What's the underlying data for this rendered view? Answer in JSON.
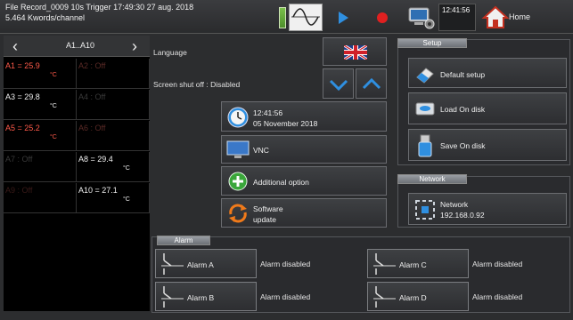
{
  "topbar": {
    "record_line": "File Record_0009  10s  Trigger 17:49:30 27 aug. 2018",
    "size_line": "5.464 Kwords/channel",
    "clock_time": "12:41:56",
    "home_label": "Home"
  },
  "channels": {
    "range_label": "A1..A10",
    "items": [
      {
        "value": "A1 = 25.9",
        "unit": "°C",
        "color": "#ff5a4a"
      },
      {
        "value": "A2 : Off",
        "unit": "",
        "color": "#5a2a26"
      },
      {
        "value": "A3 = 29.8",
        "unit": "°C",
        "color": "#f0f0f0"
      },
      {
        "value": "A4 : Off",
        "unit": "",
        "color": "#3a3a3a"
      },
      {
        "value": "A5 = 25.2",
        "unit": "°C",
        "color": "#ff5a4a"
      },
      {
        "value": "A6 : Off",
        "unit": "",
        "color": "#5a2a26"
      },
      {
        "value": "A7 : Off",
        "unit": "",
        "color": "#3a3a3a"
      },
      {
        "value": "A8 = 29.4",
        "unit": "°C",
        "color": "#f0f0f0"
      },
      {
        "value": "A9 : Off",
        "unit": "",
        "color": "#3a1a18"
      },
      {
        "value": "A10 = 27.1",
        "unit": "°C",
        "color": "#f0f0f0"
      }
    ]
  },
  "settings": {
    "language_label": "Language",
    "screen_shutoff_label": "Screen shut off : Disabled",
    "datetime_time": "12:41:56",
    "datetime_date": "05 November 2018",
    "vnc_label": "VNC",
    "additional_option_label": "Additional option",
    "software_update_line1": "Software",
    "software_update_line2": "update"
  },
  "setup": {
    "header": "Setup",
    "default_setup": "Default setup",
    "load_on_disk": "Load On disk",
    "save_on_disk": "Save On disk"
  },
  "network": {
    "header": "Network",
    "label": "Network",
    "ip": "192.168.0.92"
  },
  "alarm": {
    "header": "Alarm",
    "items": [
      {
        "name": "Alarm  A",
        "status": "Alarm disabled"
      },
      {
        "name": "Alarm  B",
        "status": "Alarm disabled"
      },
      {
        "name": "Alarm  C",
        "status": "Alarm disabled"
      },
      {
        "name": "Alarm  D",
        "status": "Alarm disabled"
      }
    ]
  },
  "colors": {
    "accent_blue": "#2f8fe0",
    "record_red": "#e02020",
    "battery_green": "#5aa832",
    "add_green": "#3aa63a",
    "update_orange": "#f07a1a"
  },
  "icons": [
    "waveform-icon",
    "play-icon",
    "record-icon",
    "pc-settings-icon",
    "home-icon",
    "uk-flag-icon",
    "chevron-down-icon",
    "chevron-up-icon",
    "clock-icon",
    "monitor-icon",
    "plus-icon",
    "refresh-icon",
    "eraser-icon",
    "disk-icon",
    "usb-icon",
    "network-icon",
    "alarm-switch-icon"
  ]
}
